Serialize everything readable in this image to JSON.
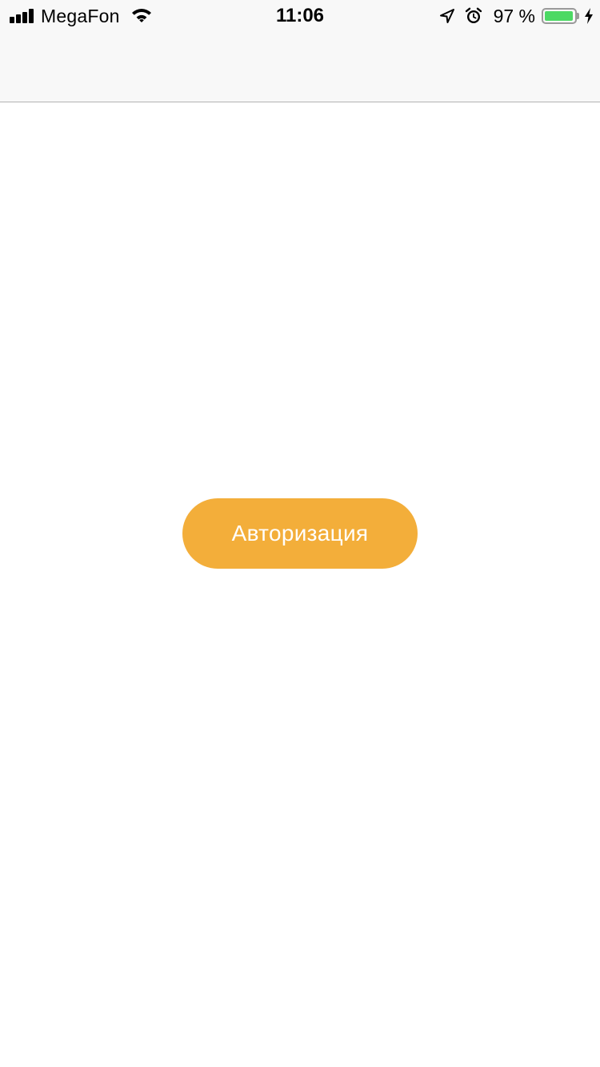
{
  "status_bar": {
    "carrier": "MegaFon",
    "time": "11:06",
    "battery_percent": "97 %",
    "battery_level": 0.97,
    "icons": [
      "signal-bars-icon",
      "wifi-icon",
      "location-arrow-icon",
      "alarm-clock-icon",
      "battery-icon",
      "charging-bolt-icon"
    ]
  },
  "main": {
    "auth_button_label": "Авторизация"
  },
  "colors": {
    "accent": "#f3ae3a",
    "battery_fill": "#4cd964",
    "nav_background": "#f8f8f8"
  }
}
